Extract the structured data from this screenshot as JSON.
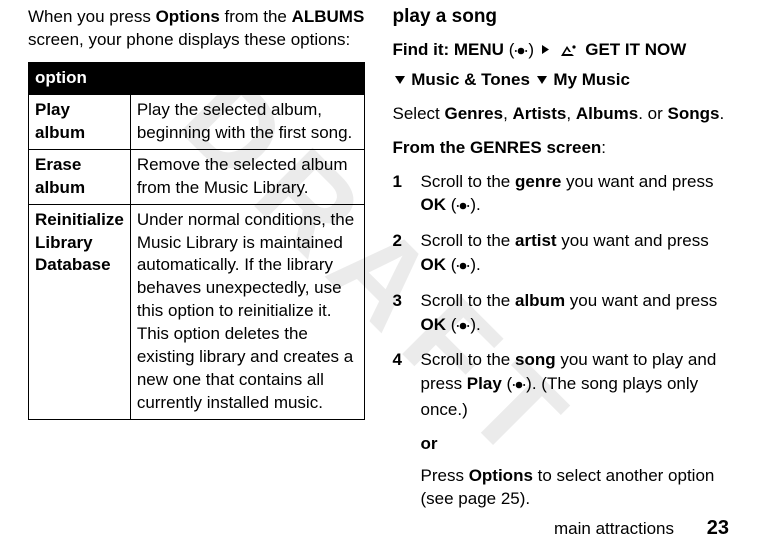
{
  "watermark": "DRAFT",
  "left": {
    "intro_pre": "When you press ",
    "intro_opts": "Options",
    "intro_mid": " from the ",
    "intro_albums": "ALBUMS",
    "intro_post": " screen, your phone displays these options:",
    "table_header": "option",
    "rows": [
      {
        "name": "Play album",
        "desc": "Play the selected album, beginning with the first song."
      },
      {
        "name": "Erase album",
        "desc": "Remove the selected album from the Music Library."
      },
      {
        "name": "Reinitialize Library Database",
        "desc": "Under normal conditions, the Music Library is maintained automatically. If the library behaves unexpectedly, use this option to reinitialize it. This option deletes the existing library and creates a new one that contains all currently installed music."
      }
    ]
  },
  "right": {
    "heading": "play a song",
    "findit_label": "Find it:",
    "menu": "MENU",
    "getit": "GET IT NOW",
    "music_tones": "Music & Tones",
    "my_music": "My Music",
    "select_pre": "Select ",
    "g": "Genres",
    "comma1": ", ",
    "a": "Artists",
    "comma2": ", ",
    "al": "Albums",
    "dot_or": ". or ",
    "s": "Songs",
    "dot": ".",
    "from_the": "From the ",
    "genres_caps": "GENRES",
    "screen": " screen",
    "colon": ":",
    "steps": [
      {
        "pre": "Scroll to the ",
        "bold": "genre",
        "mid": " you want and press ",
        "ok": "OK",
        "paren_open": " (",
        "paren_close": ")."
      },
      {
        "pre": "Scroll to the ",
        "bold": "artist",
        "mid": " you want and press ",
        "ok": "OK",
        "paren_open": " (",
        "paren_close": ")."
      },
      {
        "pre": "Scroll to the ",
        "bold": "album",
        "mid": " you want and press ",
        "ok": "OK",
        "paren_open": " (",
        "paren_close": ")."
      },
      {
        "pre": "Scroll to the ",
        "bold": "song",
        "mid": " you want to play and press ",
        "ok": "Play",
        "paren_open": " (",
        "paren_close": "). (The song plays only once.)"
      }
    ],
    "or": "or",
    "after_or_pre": "Press ",
    "after_or_opts": "Options",
    "after_or_post": " to select another option (see page 25)."
  },
  "footer": {
    "section": "main attractions",
    "page": "23"
  }
}
